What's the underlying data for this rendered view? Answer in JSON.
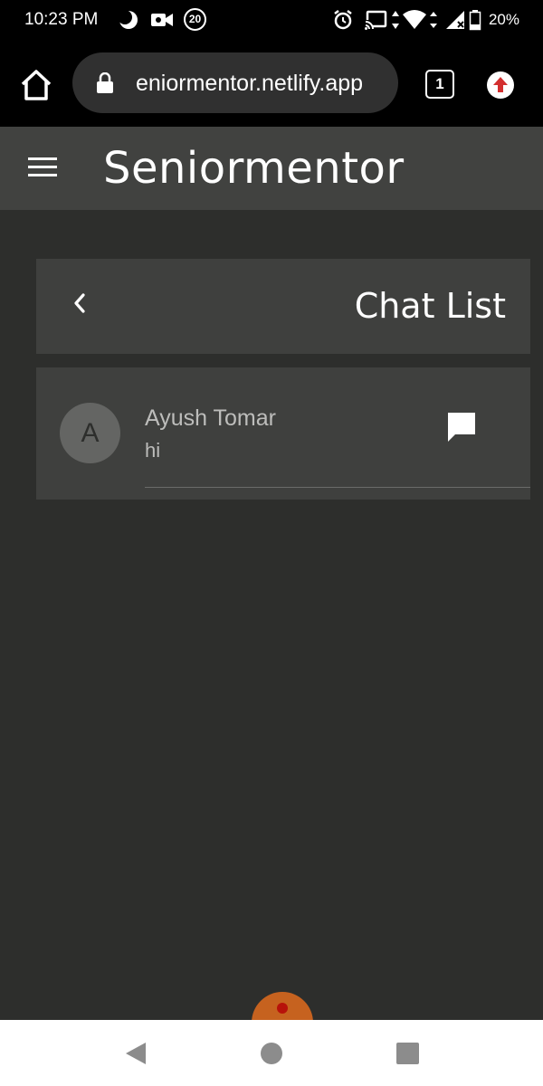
{
  "status_bar": {
    "time": "10:23 PM",
    "notification_badge": "20",
    "battery": "20%",
    "icons": [
      "moon-icon",
      "video-camera-icon",
      "badge-icon",
      "alarm-icon",
      "cast-icon",
      "data-arrows-icon",
      "wifi-icon",
      "signal-icon",
      "battery-icon"
    ]
  },
  "browser": {
    "url": "eniormentor.netlify.app",
    "tab_count": "1"
  },
  "app": {
    "title": "Seniormentor"
  },
  "chat_list": {
    "title": "Chat List",
    "items": [
      {
        "initial": "A",
        "name": "Ayush Tomar",
        "last_message": "hi"
      }
    ]
  },
  "colors": {
    "background": "#2d2e2c",
    "header": "#414240",
    "card": "#3f403e",
    "avatar": "#646563",
    "fab": "#c6621f"
  }
}
